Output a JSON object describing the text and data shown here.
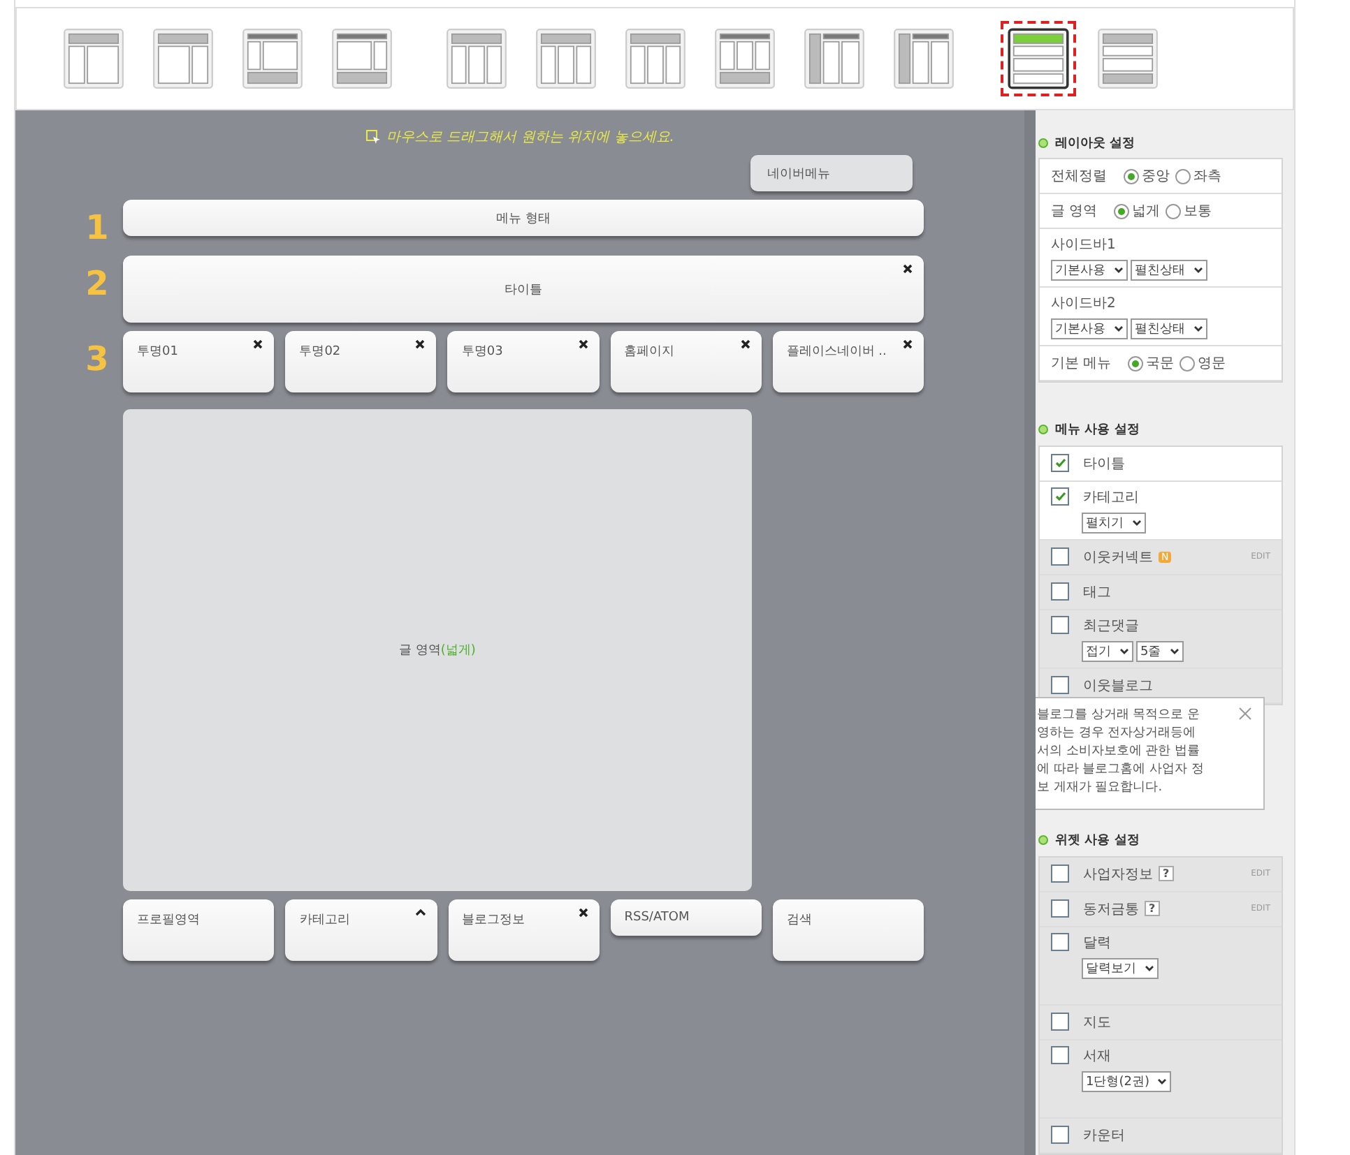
{
  "layout_picker": [
    {
      "kind": "left-col",
      "selected": false
    },
    {
      "kind": "right-col",
      "selected": false
    },
    {
      "kind": "left-col-footer",
      "selected": false
    },
    {
      "kind": "right-col-footer",
      "selected": false
    },
    {
      "kind": "three-col",
      "selected": false
    },
    {
      "kind": "three-col",
      "selected": false
    },
    {
      "kind": "three-col",
      "selected": false
    },
    {
      "kind": "three-col-footer",
      "selected": false
    },
    {
      "kind": "side-two-col",
      "selected": false
    },
    {
      "kind": "side-two-col",
      "selected": false
    },
    {
      "kind": "stack",
      "selected": true
    },
    {
      "kind": "stack",
      "selected": false
    }
  ],
  "canvas": {
    "hint": "마우스로 드래그해서 원하는 위치에 놓으세요.",
    "top_widget": "네이버메뉴",
    "rows": [
      {
        "number": "1",
        "widgets": [
          {
            "label": "메뉴 형태",
            "kind": "bar"
          }
        ]
      },
      {
        "number": "2",
        "widgets": [
          {
            "label": "타이틀",
            "kind": "title"
          }
        ]
      },
      {
        "number": "3",
        "widgets": [
          {
            "label": "투명01",
            "kind": "close"
          },
          {
            "label": "투명02",
            "kind": "close"
          },
          {
            "label": "투명03",
            "kind": "close"
          },
          {
            "label": "홈페이지",
            "kind": "close"
          },
          {
            "label": "플레이스네이버 ..",
            "kind": "close"
          }
        ]
      }
    ],
    "content": {
      "label": "글 영역",
      "note": "(넓게)"
    },
    "bottom_widgets": [
      {
        "label": "프로필영역",
        "kind": "plain"
      },
      {
        "label": "카테고리",
        "kind": "collapse"
      },
      {
        "label": "블로그정보",
        "kind": "close"
      },
      {
        "label": "RSS/ATOM",
        "kind": "compact"
      },
      {
        "label": "검색",
        "kind": "plain"
      }
    ]
  },
  "layout_settings": {
    "title": "레이아웃 설정",
    "rows": [
      {
        "kind": "radio",
        "label": "전체정렬",
        "options": [
          {
            "label": "중앙",
            "selected": true
          },
          {
            "label": "좌측",
            "selected": false
          }
        ]
      },
      {
        "kind": "radio",
        "label": "글 영역",
        "options": [
          {
            "label": "넓게",
            "selected": true
          },
          {
            "label": "보통",
            "selected": false
          }
        ]
      },
      {
        "kind": "selects",
        "label": "사이드바1",
        "selects": [
          "기본사용",
          "펼친상태"
        ]
      },
      {
        "kind": "selects",
        "label": "사이드바2",
        "selects": [
          "기본사용",
          "펼친상태"
        ]
      },
      {
        "kind": "radio",
        "label": "기본 메뉴",
        "options": [
          {
            "label": "국문",
            "selected": true
          },
          {
            "label": "영문",
            "selected": false
          }
        ]
      }
    ]
  },
  "menu_settings": {
    "title": "메뉴 사용 설정",
    "items": [
      {
        "label": "타이틀",
        "checked": true
      },
      {
        "label": "카테고리",
        "checked": true,
        "selects": [
          "펼치기"
        ]
      },
      {
        "label": "이웃커넥트",
        "checked": false,
        "badge": "N",
        "edit": "EDIT"
      },
      {
        "label": "태그",
        "checked": false
      },
      {
        "label": "최근댓글",
        "checked": false,
        "selects": [
          "접기",
          "5줄"
        ]
      },
      {
        "label": "이웃블로그",
        "checked": false
      }
    ]
  },
  "tooltip": {
    "text": "블로그를 상거래 목적으로 운영하는 경우 전자상거래등에서의 소비자보호에 관한 법률에 따라 블로그홈에 사업자 정보 게재가 필요합니다."
  },
  "widget_settings": {
    "title": "위젯 사용 설정",
    "items": [
      {
        "label": "사업자정보",
        "checked": false,
        "help": "?",
        "edit": "EDIT"
      },
      {
        "label": "동저금통",
        "checked": false,
        "help": "?",
        "edit": "EDIT"
      },
      {
        "label": "달력",
        "checked": false,
        "selects": [
          "달력보기"
        ]
      },
      {
        "label": "지도",
        "checked": false
      },
      {
        "label": "서재",
        "checked": false,
        "selects": [
          "1단형(2권)"
        ]
      },
      {
        "label": "카운터",
        "checked": false
      }
    ]
  }
}
